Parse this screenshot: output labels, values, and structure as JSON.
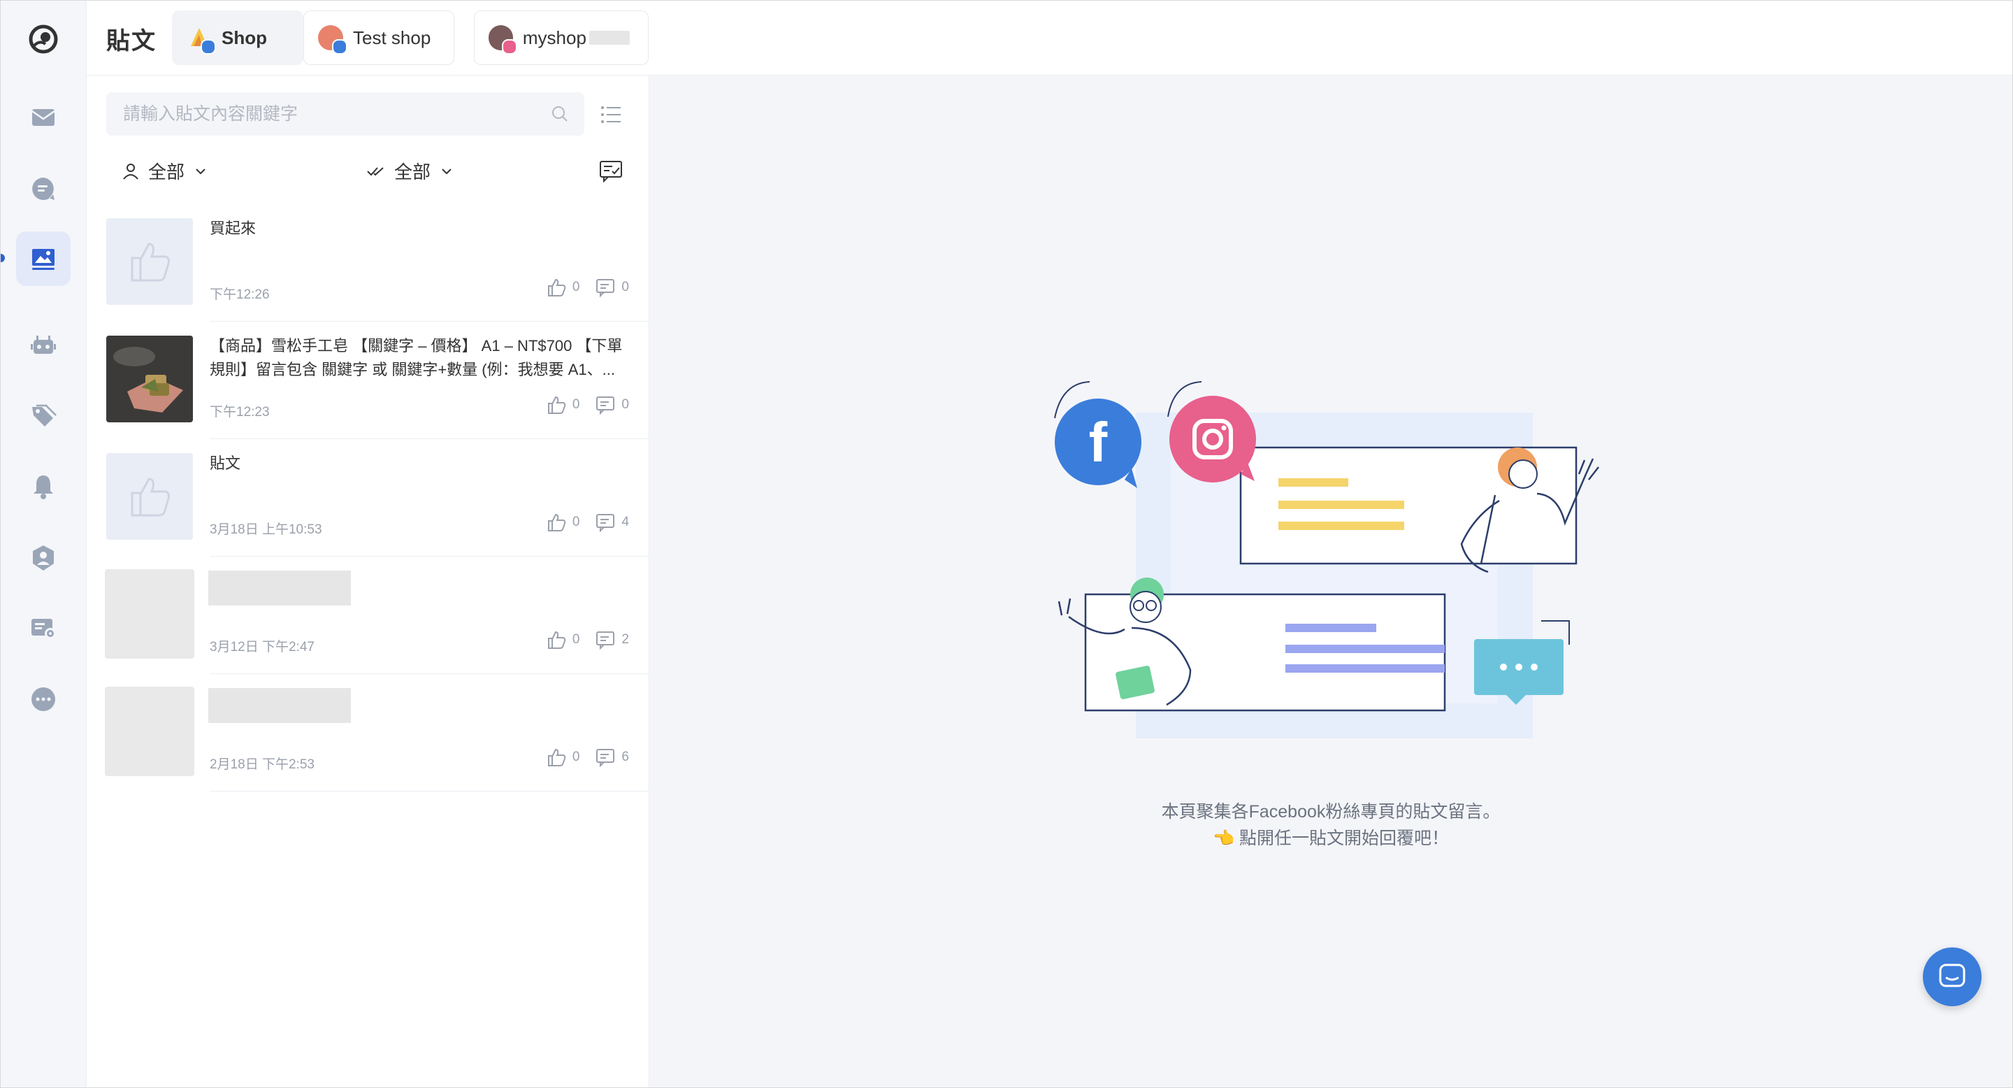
{
  "header": {
    "page_title": "貼文",
    "shop_tabs": [
      {
        "label": "Shop",
        "avatar_color": "#f5c542",
        "badge": "facebook",
        "active": true
      },
      {
        "label": "Test shop",
        "avatar_color": "#e8826a",
        "badge": "facebook",
        "active": false
      },
      {
        "label": "myshop",
        "avatar_color": "#7a5a5a",
        "badge": "instagram",
        "active": false
      }
    ]
  },
  "sidebar": {
    "items": [
      {
        "icon": "inbox-icon"
      },
      {
        "icon": "chat-bubble-icon"
      },
      {
        "icon": "image-post-icon",
        "active": true
      },
      {
        "icon": "bot-icon"
      },
      {
        "icon": "tag-icon"
      },
      {
        "icon": "bell-icon"
      },
      {
        "icon": "user-shield-icon"
      },
      {
        "icon": "card-settings-icon"
      },
      {
        "icon": "more-icon"
      }
    ]
  },
  "posts_panel": {
    "search_placeholder": "請輸入貼文內容關鍵字",
    "filter_user_label": "全部",
    "filter_status_label": "全部",
    "posts": [
      {
        "title": "買起來",
        "time": "下午12:26",
        "likes": "0",
        "comments": "0",
        "thumb": "placeholder"
      },
      {
        "title": "【商品】雪松手工皂 【關鍵字 – 價格】 A1 – NT$700 【下單規則】留言包含 關鍵字 或 關鍵字+數量 (例：我想要 A1、...",
        "time": "下午12:23",
        "likes": "0",
        "comments": "0",
        "thumb": "photo"
      },
      {
        "title": "貼文",
        "time": "3月18日 上午10:53",
        "likes": "0",
        "comments": "4",
        "thumb": "placeholder"
      },
      {
        "title": "",
        "time": "3月12日 下午2:47",
        "likes": "0",
        "comments": "2",
        "thumb": "grey"
      },
      {
        "title": "",
        "time": "2月18日 下午2:53",
        "likes": "0",
        "comments": "6",
        "thumb": "grey"
      }
    ]
  },
  "main": {
    "caption_line1": "本頁聚集各Facebook粉絲專頁的貼文留言。",
    "caption_line2": "👈 點開任一貼文開始回覆吧！"
  },
  "colors": {
    "accent": "#2f5fd0",
    "facebook": "#3b7ddb",
    "instagram": "#e8608c",
    "chat_button": "#3b7ddb"
  }
}
